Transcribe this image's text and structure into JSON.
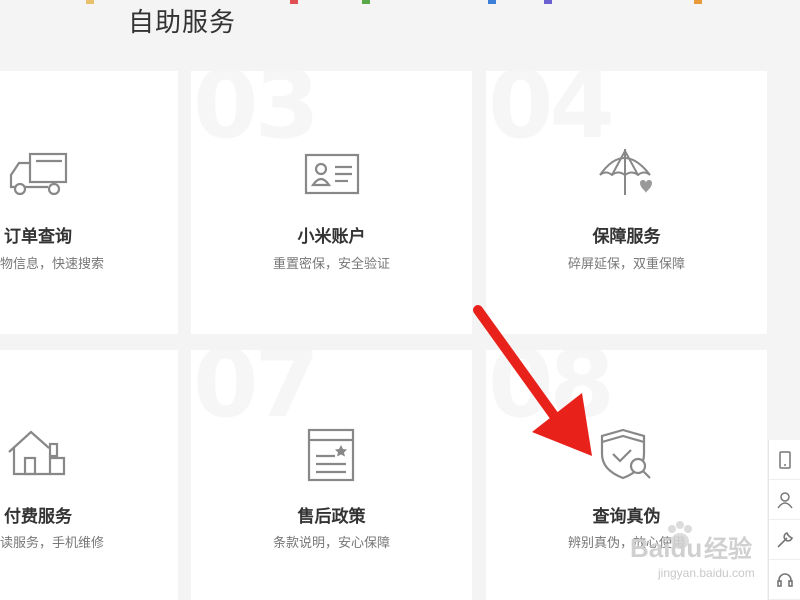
{
  "page": {
    "title": "自助服务"
  },
  "cards": [
    {
      "num": "",
      "label": "订单查询",
      "desc": "物信息，快速搜索",
      "icon": "truck-icon"
    },
    {
      "num": "03",
      "label": "小米账户",
      "desc": "重置密保，安全验证",
      "icon": "id-card-icon"
    },
    {
      "num": "04",
      "label": "保障服务",
      "desc": "碎屏延保，双重保障",
      "icon": "umbrella-heart-icon"
    },
    {
      "num": "",
      "label": "付费服务",
      "desc": "读服务，手机维修",
      "icon": "house-icon"
    },
    {
      "num": "07",
      "label": "售后政策",
      "desc": "条款说明，安心保障",
      "icon": "document-icon"
    },
    {
      "num": "08",
      "label": "查询真伪",
      "desc": "辨别真伪，放心使用",
      "icon": "shield-check-icon"
    }
  ],
  "sidebar": {
    "items": [
      "phone-icon",
      "user-icon",
      "wrench-icon",
      "headset-icon"
    ]
  },
  "watermark": {
    "text": "jingyan.baidu.com",
    "brand": "Baidu",
    "brand_suffix": "经验"
  },
  "colors": {
    "accent": "#e8221b",
    "icon": "#888888",
    "title": "#333333"
  }
}
